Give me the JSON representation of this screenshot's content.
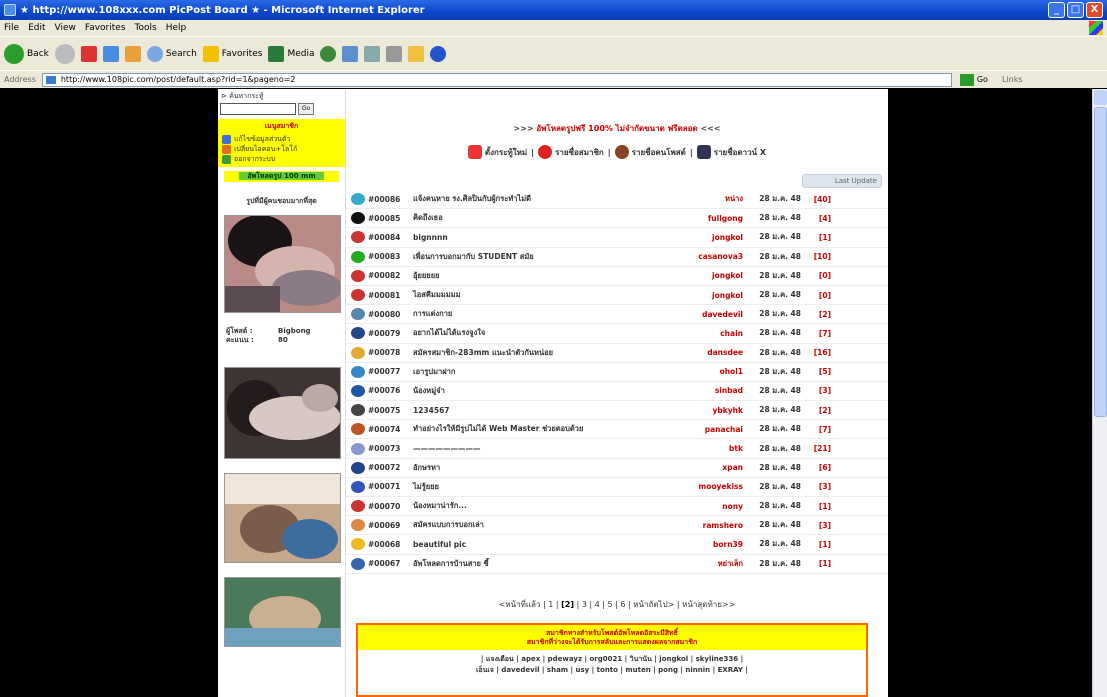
{
  "window": {
    "title": "★ http://www.108xxx.com PicPost Board ★ - Microsoft Internet Explorer",
    "buttons": [
      "_",
      "□",
      "X"
    ]
  },
  "menu": [
    "File",
    "Edit",
    "View",
    "Favorites",
    "Tools",
    "Help"
  ],
  "toolbar": {
    "back": "Back",
    "search": "Search",
    "favorites": "Favorites",
    "media": "Media"
  },
  "address": {
    "label": "Address",
    "url": "http://www.108pic.com/post/default.asp?rid=1&pageno=2",
    "go": "Go",
    "links": "Links"
  },
  "sidebar": {
    "search_label": "⊳ ค้นหากระทู้",
    "search_button": "Go",
    "member_head": "เมนูสมาชิก",
    "member_items": [
      {
        "label": "แก้ไขข้อมูลส่วนตัว",
        "color": "#3a6fd8"
      },
      {
        "label": "เปลี่ยนไอคอน+โลโก้",
        "color": "#e07020"
      },
      {
        "label": "ออกจากระบบ",
        "color": "#3c9c3c"
      }
    ],
    "green_button": "อัพโหลดรูป 100 mm",
    "section_title": "รูปที่มีผู้คนชอบมากที่สุด",
    "stats": [
      {
        "k": "ผู้โพสต์ :",
        "v": "Bigbong"
      },
      {
        "k": "คะแนน :",
        "v": "80"
      }
    ]
  },
  "banner": {
    "left": ">>> ",
    "text": "อัพโหลดรูปฟรี 100% ไม่จำกัดขนาด ฟรีตลอด",
    "right": " <<<"
  },
  "nav": [
    {
      "label": "ตั้งกระทู้ใหม่",
      "color": "#e33"
    },
    {
      "label": "รายชื่อสมาชิก",
      "color": "#d22"
    },
    {
      "label": "รายชื่อคนโพสต์",
      "color": "#842"
    },
    {
      "label": "รายชื่อดาวน์ X",
      "color": "#335"
    }
  ],
  "last_update": "Last Update",
  "threads": [
    {
      "id": "#00086",
      "icon": "#3ac",
      "title": "แจ้งคนหาย รง.ศิลปินกับผู้กระทำไม่ดี",
      "author": "หน่าง",
      "date": "28 ม.ค. 48",
      "count": "[40]"
    },
    {
      "id": "#00085",
      "icon": "#111",
      "title": "คิดถึงเธอ",
      "author": "fullgong",
      "date": "28 ม.ค. 48",
      "count": "[4]"
    },
    {
      "id": "#00084",
      "icon": "#c33",
      "title": "bignnnn",
      "author": "jongkol",
      "date": "28 ม.ค. 48",
      "count": "[1]"
    },
    {
      "id": "#00083",
      "icon": "#2a2",
      "title": "เพื่อนการบอกมากับ STUDENT สมัย",
      "author": "casanova3",
      "date": "28 ม.ค. 48",
      "count": "[10]"
    },
    {
      "id": "#00082",
      "icon": "#c33",
      "title": "อุ้ยยยยย",
      "author": "jongkol",
      "date": "28 ม.ค. 48",
      "count": "[0]"
    },
    {
      "id": "#00081",
      "icon": "#c33",
      "title": "ไอสคีมมมมมม",
      "author": "jongkol",
      "date": "28 ม.ค. 48",
      "count": "[0]"
    },
    {
      "id": "#00080",
      "icon": "#58a",
      "title": "การแต่งกาย",
      "author": "davedevil",
      "date": "28 ม.ค. 48",
      "count": "[2]"
    },
    {
      "id": "#00079",
      "icon": "#248",
      "title": "อยากได้ไม่ได้แรงจูงใจ",
      "author": "chain",
      "date": "28 ม.ค. 48",
      "count": "[7]"
    },
    {
      "id": "#00078",
      "icon": "#da3",
      "title": "สมัครสมาชิก-283mm แนะนำตัวกันหน่อย",
      "author": "dansdee",
      "date": "28 ม.ค. 48",
      "count": "[16]"
    },
    {
      "id": "#00077",
      "icon": "#38c",
      "title": "เอารูปมาฝาก",
      "author": "ohol1",
      "date": "28 ม.ค. 48",
      "count": "[5]"
    },
    {
      "id": "#00076",
      "icon": "#25a",
      "title": "น้องหมู่จ๋า",
      "author": "sinbad",
      "date": "28 ม.ค. 48",
      "count": "[3]"
    },
    {
      "id": "#00075",
      "icon": "#444",
      "title": "1234567",
      "author": "ybkyhk",
      "date": "28 ม.ค. 48",
      "count": "[2]"
    },
    {
      "id": "#00074",
      "icon": "#b52",
      "title": "ทำอย่างไรให้มีรูปไม่ได้ Web Master ช่วยตอบด้วย",
      "author": "panachai",
      "date": "28 ม.ค. 48",
      "count": "[7]"
    },
    {
      "id": "#00073",
      "icon": "#89c",
      "title": "—————————",
      "author": "btk",
      "date": "28 ม.ค. 48",
      "count": "[21]"
    },
    {
      "id": "#00072",
      "icon": "#248",
      "title": "อักษรหา",
      "author": "xpan",
      "date": "28 ม.ค. 48",
      "count": "[6]"
    },
    {
      "id": "#00071",
      "icon": "#35b",
      "title": "ไม่รู้ยยย",
      "author": "mooyekiss",
      "date": "28 ม.ค. 48",
      "count": "[3]"
    },
    {
      "id": "#00070",
      "icon": "#c33",
      "title": "น้องหมาน่ารัก...",
      "author": "nony",
      "date": "28 ม.ค. 48",
      "count": "[1]"
    },
    {
      "id": "#00069",
      "icon": "#d84",
      "title": "สมัครแบบการบอกเล่า",
      "author": "ramshero",
      "date": "28 ม.ค. 48",
      "count": "[3]"
    },
    {
      "id": "#00068",
      "icon": "#eb2",
      "title": "beautiful pic",
      "author": "born39",
      "date": "28 ม.ค. 48",
      "count": "[1]"
    },
    {
      "id": "#00067",
      "icon": "#36a",
      "title": "อัพโหลดการบ้านสาย ชี้",
      "author": "หย่าเล็ก",
      "date": "28 ม.ค. 48",
      "count": "[1]"
    }
  ],
  "pager": {
    "prev": "<หน้าที่แล้ว |",
    "pages": [
      "1",
      "[2]",
      "3",
      "4",
      "5",
      "6"
    ],
    "next": "| หน้าถัดไป> | หน้าสุดท้าย>>"
  },
  "footer_box": {
    "line1": "สมาชิกทางสำหรับโพสต์อัพโหลดอิสระมีสิทธิ์",
    "line2": "สมาชิกที่ว่างจะได้รับการสลับและการแสดงผลจากสมาชิก",
    "members_line1": "| แจงเตือน | apex | pdewayz | org0021 | วินานัน | jongkol | skyline336 |",
    "members_line2": "เอ็นเจ | davedevil | sham | usy | tonto | muten | pong | ninnin | EXRAY |"
  }
}
